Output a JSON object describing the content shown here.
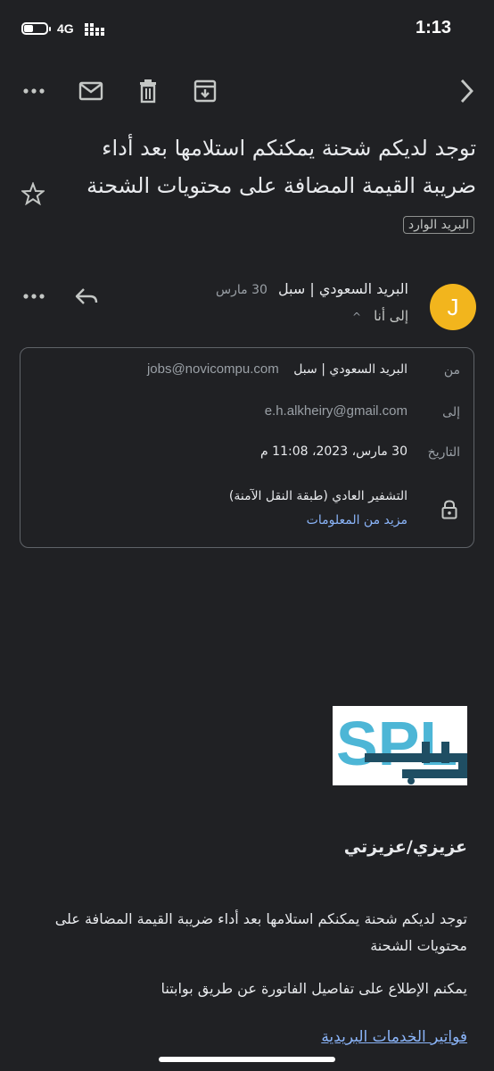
{
  "status_bar": {
    "time": "1:13",
    "network": "4G"
  },
  "toolbar": {
    "icons": [
      "more-horiz-icon",
      "mark-unread-icon",
      "delete-icon",
      "archive-icon",
      "chevron-right-icon"
    ]
  },
  "email": {
    "subject": "توجد لديكم شحنة يمكنكم استلامها بعد أداء ضريبة القيمة المضافة على محتويات الشحنة",
    "label": "البريد الوارد",
    "avatar_letter": "J",
    "sender_name": "البريد السعودي | سبل",
    "date_short": "30 مارس",
    "to_me": "إلى أنا"
  },
  "details": {
    "from_label": "من",
    "from_name": "البريد السعودي | سبل",
    "from_email": "jobs@novicompu.com",
    "to_label": "إلى",
    "to_email": "e.h.alkheiry@gmail.com",
    "date_label": "التاريخ",
    "date_value": "30 مارس، 2023، 11:08 م",
    "encryption": "التشفير العادي (طبقة النقل الآمنة)",
    "more_info": "مزيد من المعلومات"
  },
  "body": {
    "greeting": "عزيزي/عزيزتي",
    "paragraph1": "توجد لديكم شحنة يمكنكم استلامها بعد أداء ضريبة القيمة المضافة على محتويات الشحنة",
    "paragraph2": "يمكنم الإطلاع على تفاصيل الفاتورة عن طريق بوابتنا",
    "link": "فواتير الخدمات البريدية"
  },
  "colors": {
    "background": "#202124",
    "avatar": "#f2b51d",
    "link": "#8ab4f8",
    "logo_blue": "#4db6d6",
    "logo_dark": "#1f4e63"
  }
}
